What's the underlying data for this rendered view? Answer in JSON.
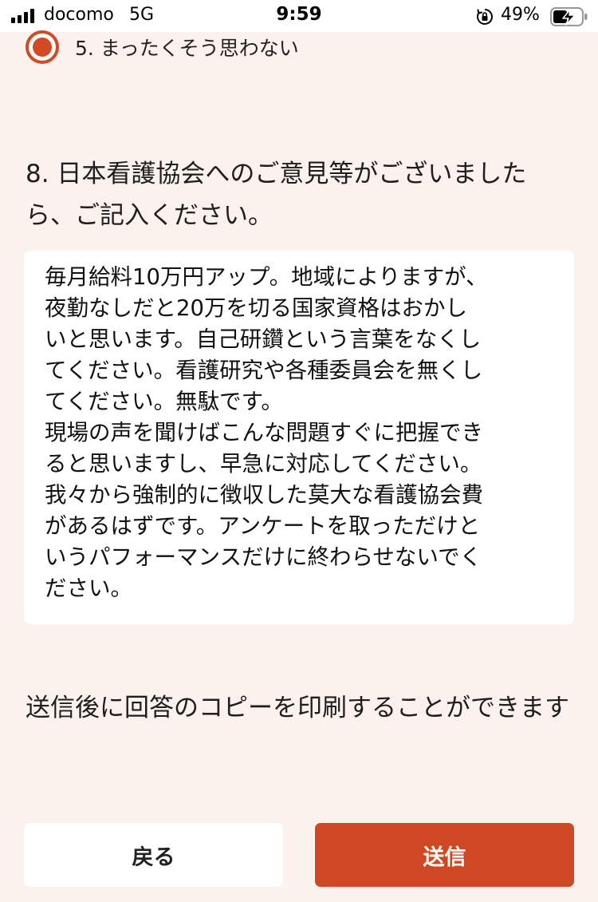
{
  "status_bar": {
    "carrier": "docomo",
    "network": "5G",
    "time": "9:59",
    "battery_percent": "49%",
    "icons": [
      "signal-icon",
      "orientation-lock-icon",
      "battery-charging-icon"
    ]
  },
  "previous_option": {
    "label": "5. まったくそう思わない",
    "selected": true,
    "accent_color": "#d24a23"
  },
  "question": {
    "text": "8. 日本看護協会へのご意見等がございましたら、ご記入ください。"
  },
  "answer": {
    "value": "毎月給料10万円アップ。地域によりますが、\n夜勤なしだと20万を切る国家資格はおかし\nいと思います。自己研鑽という言葉をなくし\nてください。看護研究や各種委員会を無くし\nてください。無駄です。\n現場の声を聞けばこんな問題すぐに把握でき\nると思いますし、早急に対応してください。\n我々から強制的に徴収した莫大な看護協会費\nがあるはずです。アンケートを取っただけと\nいうパフォーマンスだけに終わらせないでく\nださい。"
  },
  "print_note": "送信後に回答のコピーを印刷することができます",
  "buttons": {
    "back_label": "戻る",
    "submit_label": "送信",
    "submit_color": "#cf4823"
  }
}
